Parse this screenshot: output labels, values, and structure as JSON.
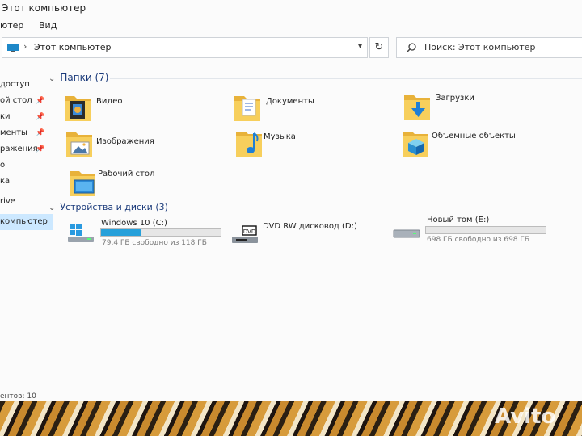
{
  "window": {
    "title": "Этот компьютер"
  },
  "menu": {
    "items": [
      "ютер",
      "Вид"
    ]
  },
  "address": {
    "path": "Этот компьютер",
    "separator": "›"
  },
  "search": {
    "placeholder": "Поиск: Этот компьютер"
  },
  "sidebar": {
    "items": [
      {
        "label": "доступ",
        "pinned": false,
        "selected": false
      },
      {
        "label": "ой стол",
        "pinned": true,
        "selected": false
      },
      {
        "label": "ки",
        "pinned": true,
        "selected": false
      },
      {
        "label": "менты",
        "pinned": true,
        "selected": false
      },
      {
        "label": "ражения",
        "pinned": true,
        "selected": false
      },
      {
        "label": "о",
        "pinned": false,
        "selected": false
      },
      {
        "label": "ка",
        "pinned": false,
        "selected": false
      },
      {
        "label": "rive",
        "pinned": false,
        "selected": false
      },
      {
        "label": "компьютер",
        "pinned": false,
        "selected": true
      }
    ]
  },
  "folders_group": {
    "header": "Папки (7)",
    "items": [
      {
        "label": "Видео",
        "icon": "video-folder-icon"
      },
      {
        "label": "Документы",
        "icon": "documents-folder-icon"
      },
      {
        "label": "Загрузки",
        "icon": "downloads-folder-icon"
      },
      {
        "label": "Изображения",
        "icon": "pictures-folder-icon"
      },
      {
        "label": "Музыка",
        "icon": "music-folder-icon"
      },
      {
        "label": "Объемные объекты",
        "icon": "3d-objects-folder-icon"
      },
      {
        "label": "Рабочий стол",
        "icon": "desktop-folder-icon"
      }
    ]
  },
  "drives_group": {
    "header": "Устройства и диски (3)",
    "items": [
      {
        "name": "Windows 10 (C:)",
        "free_text": "79,4 ГБ свободно из 118 ГБ",
        "used_fraction": 0.33,
        "icon": "windows-drive-icon"
      },
      {
        "name": "DVD RW дисковод (D:)",
        "icon": "dvd-drive-icon",
        "badge": "DVD"
      },
      {
        "name": "Новый том (E:)",
        "free_text": "698 ГБ свободно из 698 ГБ",
        "used_fraction": 0.0,
        "icon": "hard-drive-icon"
      }
    ]
  },
  "status": {
    "text": "ентов: 10"
  },
  "watermark": {
    "text": "Avito"
  },
  "colors": {
    "accent": "#26a0da",
    "selection": "#cce8ff",
    "folder": "#f5c542"
  }
}
